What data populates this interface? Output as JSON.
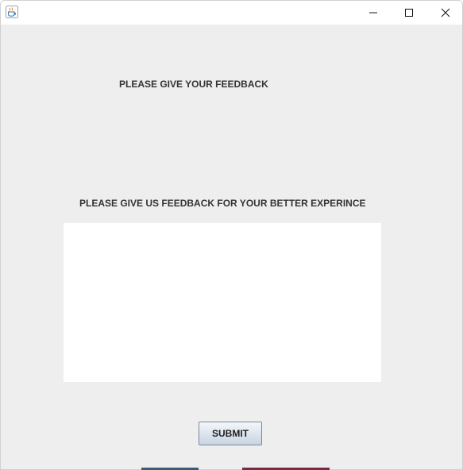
{
  "window": {
    "icon": "java-cup-icon",
    "controls": {
      "minimize": "minimize-icon",
      "maximize": "maximize-icon",
      "close": "close-icon"
    }
  },
  "form": {
    "heading": "PLEASE GIVE YOUR FEEDBACK",
    "prompt": "PLEASE GIVE US FEEDBACK FOR YOUR BETTER EXPERINCE",
    "feedback_value": "",
    "submit_label": "SUBMIT"
  },
  "colors": {
    "window_background": "#eeeeee",
    "titlebar_background": "#ffffff",
    "text": "#333333",
    "textarea_background": "#ffffff"
  }
}
